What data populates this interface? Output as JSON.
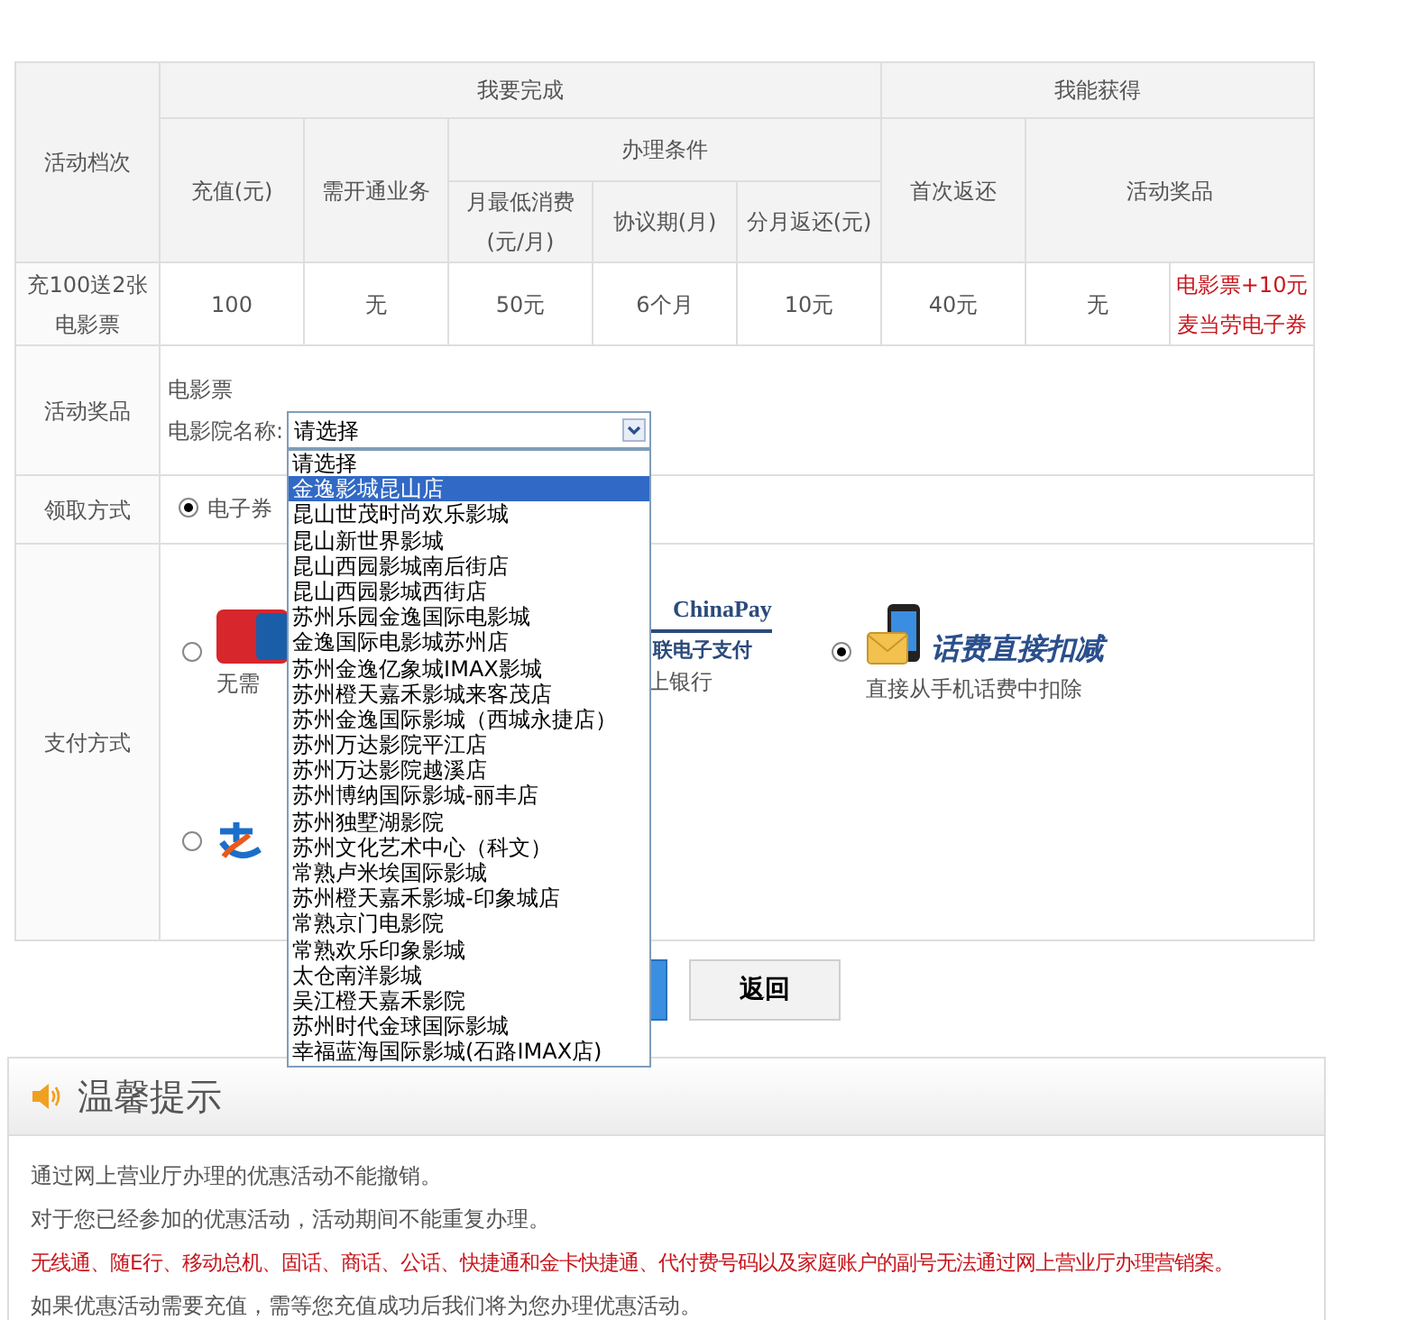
{
  "table": {
    "header_groups": [
      "活动档次",
      "我要完成",
      "我能获得"
    ],
    "header_columns": [
      "充值(元)",
      "需开通业务",
      "办理条件",
      "首次返还",
      "活动奖品"
    ],
    "condition_columns": [
      "月最低消费(元/月)",
      "协议期(月)",
      "分月返还(元)"
    ],
    "row": [
      {
        "text": "充100送2张电影票",
        "emphasis": false
      },
      {
        "text": "100",
        "emphasis": false
      },
      {
        "text": "无",
        "emphasis": false
      },
      {
        "text": "50元",
        "emphasis": false
      },
      {
        "text": "6个月",
        "emphasis": false
      },
      {
        "text": "10元",
        "emphasis": false
      },
      {
        "text": "40元",
        "emphasis": false
      },
      {
        "text": "无",
        "emphasis": false
      },
      {
        "text": "电影票+10元麦当劳电子券",
        "emphasis": true
      }
    ]
  },
  "prize": {
    "label": "活动奖品",
    "title": "电影票",
    "select_label": "电影院名称:",
    "select_value": "请选择",
    "expanded": true,
    "options": [
      {
        "label": "请选择",
        "selected": false
      },
      {
        "label": "金逸影城昆山店",
        "selected": true
      },
      {
        "label": "昆山世茂时尚欢乐影城",
        "selected": false
      },
      {
        "label": "昆山新世界影城",
        "selected": false
      },
      {
        "label": "昆山西园影城南后街店",
        "selected": false
      },
      {
        "label": "昆山西园影城西街店",
        "selected": false
      },
      {
        "label": "苏州乐园金逸国际电影城",
        "selected": false
      },
      {
        "label": "金逸国际电影城苏州店",
        "selected": false
      },
      {
        "label": "苏州金逸亿象城IMAX影城",
        "selected": false
      },
      {
        "label": "苏州橙天嘉禾影城来客茂店",
        "selected": false
      },
      {
        "label": "苏州金逸国际影城（西城永捷店）",
        "selected": false
      },
      {
        "label": "苏州万达影院平江店",
        "selected": false
      },
      {
        "label": "苏州万达影院越溪店",
        "selected": false
      },
      {
        "label": "苏州博纳国际影城-丽丰店",
        "selected": false
      },
      {
        "label": "苏州独墅湖影院",
        "selected": false
      },
      {
        "label": "苏州文化艺术中心（科文）",
        "selected": false
      },
      {
        "label": "常熟卢米埃国际影城",
        "selected": false
      },
      {
        "label": "苏州橙天嘉禾影城-印象城店",
        "selected": false
      },
      {
        "label": "常熟京门电影院",
        "selected": false
      },
      {
        "label": "常熟欢乐印象影城",
        "selected": false
      },
      {
        "label": "太仓南洋影城",
        "selected": false
      },
      {
        "label": "吴江橙天嘉禾影院",
        "selected": false
      },
      {
        "label": "苏州时代金球国际影城",
        "selected": false
      },
      {
        "label": "幸福蓝海国际影城(石路IMAX店)",
        "selected": false
      }
    ]
  },
  "pickup": {
    "label": "领取方式",
    "options": [
      {
        "label": "电子券",
        "selected": true
      }
    ]
  },
  "payment": {
    "label": "支付方式",
    "options": [
      {
        "kind": "card",
        "selected": false,
        "caption": "无需"
      },
      {
        "kind": "chinapay",
        "logo_title": "ChinaPay",
        "logo_subtitle": "联电子支付",
        "caption": "上银行"
      },
      {
        "kind": "phone",
        "selected": true,
        "title": "话费直接扣减",
        "caption": "直接从手机话费中扣除"
      },
      {
        "kind": "wallet",
        "selected": false
      }
    ]
  },
  "buttons": [
    {
      "kind": "submit"
    },
    {
      "kind": "back",
      "label": "返回"
    }
  ],
  "tips": {
    "title": "温馨提示",
    "lines": [
      {
        "text": "通过网上营业厅办理的优惠活动不能撤销。",
        "emphasis": false
      },
      {
        "text": "对于您已经参加的优惠活动，活动期间不能重复办理。",
        "emphasis": false
      },
      {
        "text": "无线通、随E行、移动总机、固话、商话、公话、快捷通和金卡快捷通、代付费号码以及家庭账户的副号无法通过网上营业厅办理营销案。",
        "emphasis": true
      },
      {
        "text": "如果优惠活动需要充值，需等您充值成功后我们将为您办理优惠活动。",
        "emphasis": false
      }
    ]
  }
}
